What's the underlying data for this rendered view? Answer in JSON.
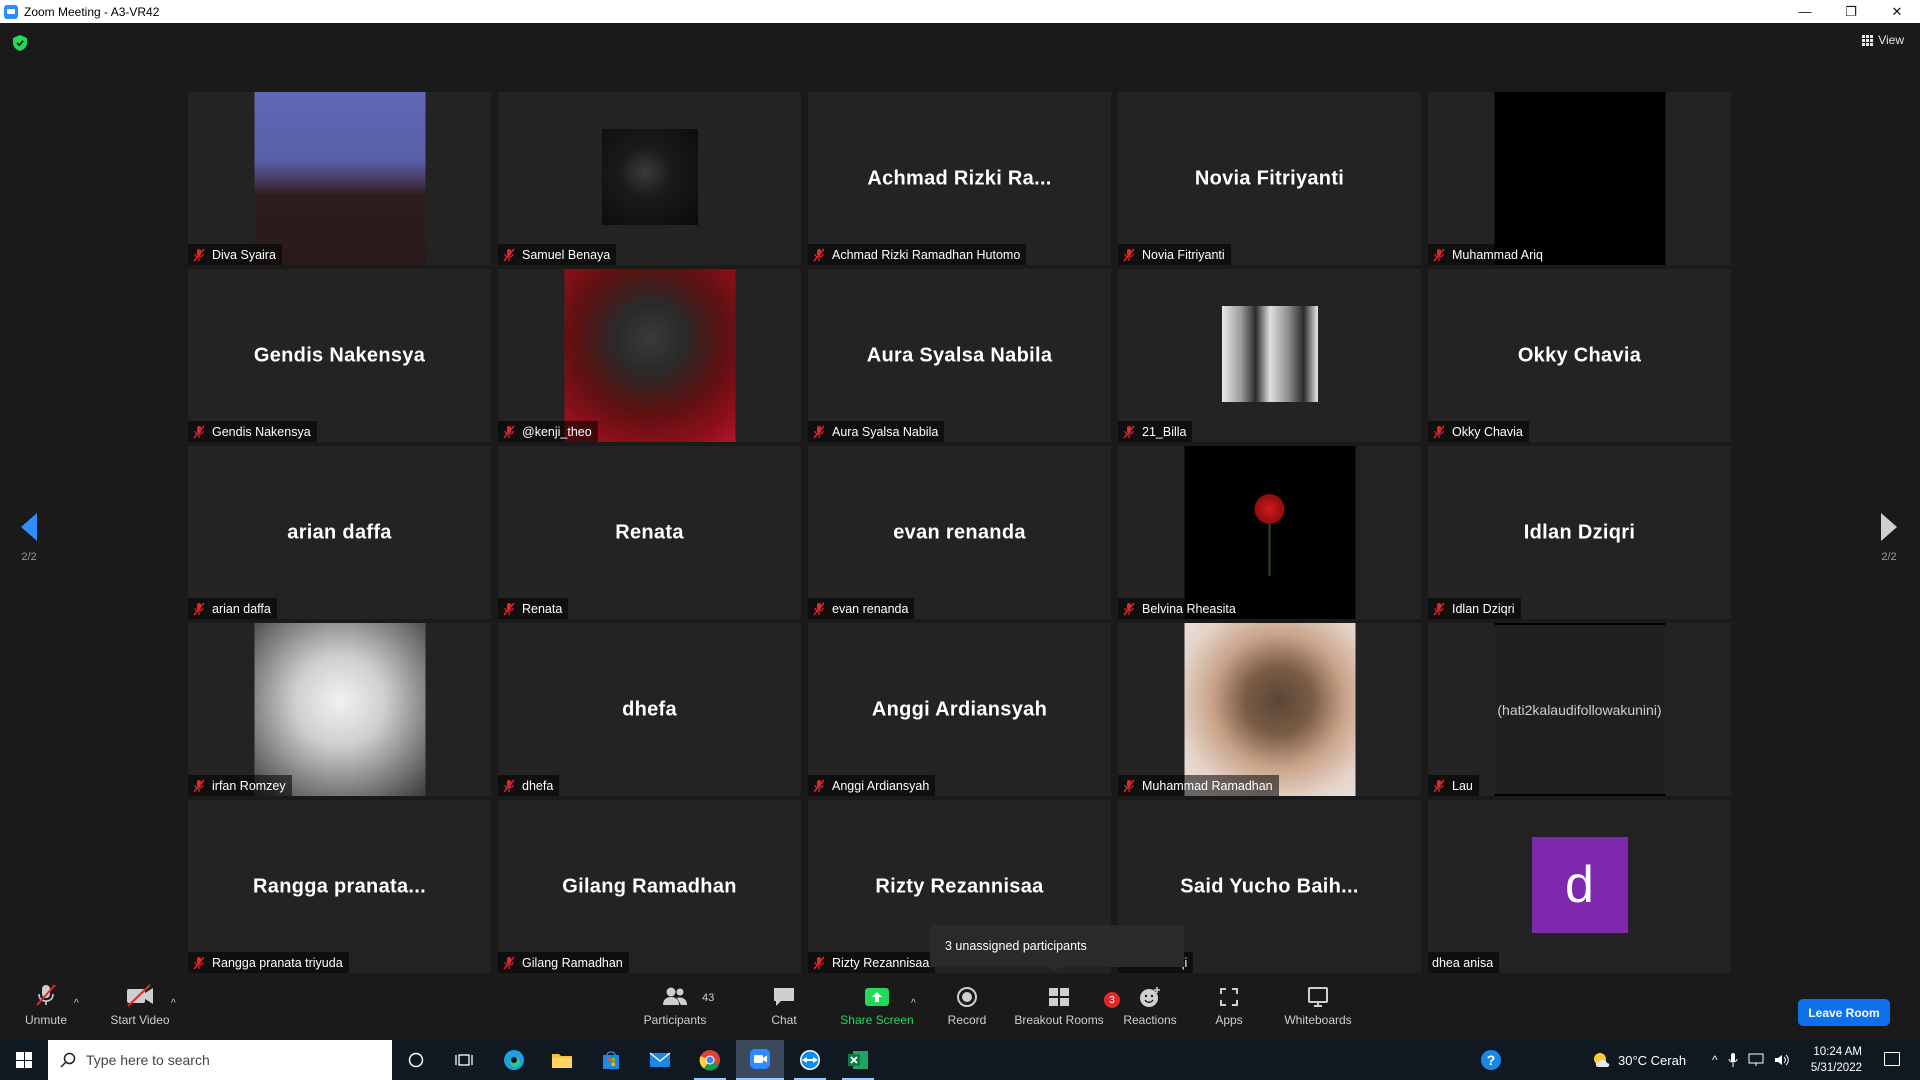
{
  "window": {
    "title": "Zoom Meeting - A3-VR42",
    "minimize": "—",
    "restore": "❐",
    "close": "✕"
  },
  "top": {
    "view_label": "View"
  },
  "pager": {
    "left_page": "2/2",
    "right_page": "2/2"
  },
  "tiles": [
    {
      "name": "Diva Syaira",
      "display": "",
      "photo": "diva",
      "muted": true
    },
    {
      "name": "Samuel Benaya",
      "display": "",
      "photo": "samuel",
      "muted": true
    },
    {
      "name": "Achmad Rizki Ramadhan Hutomo",
      "display": "Achmad  Rizki  Ra...",
      "photo": "",
      "muted": true
    },
    {
      "name": "Novia Fitriyanti",
      "display": "Novia Fitriyanti",
      "photo": "",
      "muted": true
    },
    {
      "name": "Muhammad Ariq",
      "display": "",
      "photo": "ariq",
      "muted": true
    },
    {
      "name": "Gendis Nakensya",
      "display": "Gendis Nakensya",
      "photo": "",
      "muted": true
    },
    {
      "name": "@kenji_theo",
      "display": "",
      "photo": "kenji",
      "muted": true
    },
    {
      "name": "Aura Syalsa Nabila",
      "display": "Aura Syalsa Nabila",
      "photo": "",
      "muted": true
    },
    {
      "name": "21_Billa",
      "display": "",
      "photo": "billa",
      "muted": true
    },
    {
      "name": "Okky Chavia",
      "display": "Okky Chavia",
      "photo": "",
      "muted": true
    },
    {
      "name": "arian daffa",
      "display": "arian daffa",
      "photo": "",
      "muted": true
    },
    {
      "name": "Renata",
      "display": "Renata",
      "photo": "",
      "muted": true
    },
    {
      "name": "evan renanda",
      "display": "evan renanda",
      "photo": "",
      "muted": true
    },
    {
      "name": "Belvina Rheasita",
      "display": "",
      "photo": "belvina",
      "muted": true
    },
    {
      "name": "Idlan Dziqri",
      "display": "Idlan Dziqri",
      "photo": "",
      "muted": true
    },
    {
      "name": "irfan Romzey",
      "display": "",
      "photo": "irfan",
      "muted": true
    },
    {
      "name": "dhefa",
      "display": "dhefa",
      "photo": "",
      "muted": true
    },
    {
      "name": "Anggi Ardiansyah",
      "display": "Anggi Ardiansyah",
      "photo": "",
      "muted": true
    },
    {
      "name": "Muhammad Ramadhan",
      "display": "",
      "photo": "ramadhan",
      "muted": true
    },
    {
      "name": "Lau",
      "display": "",
      "photo": "lau",
      "muted": true,
      "photo_text": "(hati2kalaudifollowakunini)"
    },
    {
      "name": "Rangga pranata triyuda",
      "display": "Rangga  pranata...",
      "photo": "",
      "muted": true
    },
    {
      "name": "Gilang Ramadhan",
      "display": "Gilang Ramadhan",
      "photo": "",
      "muted": true
    },
    {
      "name": "Rizty Rezannisaa",
      "display": "Rizty Rezannisaa",
      "photo": "",
      "muted": true
    },
    {
      "name": "cho Baihaqi",
      "display": "Said  Yucho  Baih...",
      "photo": "",
      "muted": false
    },
    {
      "name": "dhea anisa",
      "display": "",
      "photo": "avatar",
      "muted": false,
      "avatar_letter": "d"
    }
  ],
  "tooltip": "3 unassigned participants",
  "toolbar": {
    "unmute": "Unmute",
    "start_video": "Start Video",
    "participants": "Participants",
    "participants_count": "43",
    "chat": "Chat",
    "share_screen": "Share Screen",
    "record": "Record",
    "breakout_rooms": "Breakout Rooms",
    "breakout_badge": "3",
    "reactions": "Reactions",
    "apps": "Apps",
    "whiteboards": "Whiteboards",
    "leave": "Leave Room"
  },
  "taskbar": {
    "search_placeholder": "Type here to search",
    "weather": "30°C  Cerah",
    "time": "10:24 AM",
    "date": "5/31/2022"
  },
  "colors": {
    "accent": "#2d8cff",
    "share_green": "#23d959",
    "mute_red": "#e02828",
    "leave_blue": "#0e71eb",
    "avatar_purple": "#7d28ad"
  }
}
